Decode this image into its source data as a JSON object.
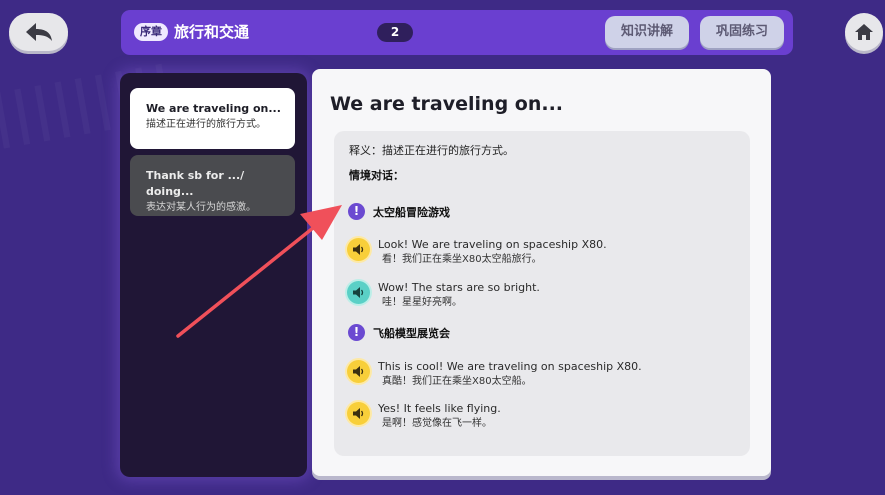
{
  "header": {
    "tag": "序章",
    "title": "旅行和交通",
    "count": "2",
    "tabs": [
      "知识讲解",
      "巩固练习"
    ]
  },
  "sidebar": {
    "items": [
      {
        "title": "We are traveling on...",
        "desc": "描述正在进行的旅行方式。",
        "active": true
      },
      {
        "title": "Thank sb for .../ doing...",
        "desc": "表达对某人行为的感激。",
        "active": false
      }
    ]
  },
  "content": {
    "title": "We are traveling on...",
    "definition": "释义：描述正在进行的旅行方式。",
    "dialog_heading": "情境对话：",
    "scenes": [
      {
        "name": "太空船冒险游戏",
        "lines": [
          {
            "en": "Look! We are traveling on spaceship X80.",
            "zh": "看！我们正在乘坐X80太空船旅行。",
            "speaker_color": "yellow"
          },
          {
            "en": "Wow! The stars are so bright.",
            "zh": "哇！星星好亮啊。",
            "speaker_color": "teal"
          }
        ]
      },
      {
        "name": "飞船模型展览会",
        "lines": [
          {
            "en": "This is cool! We are traveling on spaceship X80.",
            "zh": "真酷！我们正在乘坐X80太空船。",
            "speaker_color": "yellow"
          },
          {
            "en": "Yes! It feels like flying.",
            "zh": "是啊！感觉像在飞一样。",
            "speaker_color": "yellow"
          }
        ]
      }
    ]
  },
  "icons": {
    "back": "back-arrow-icon",
    "home": "home-icon",
    "scene": "exclamation-icon",
    "speaker": "speaker-icon"
  },
  "colors": {
    "background": "#3e2a86",
    "topbar": "#6a3fd0",
    "accent_yellow": "#f8cf3a",
    "accent_teal": "#5ad0c6",
    "scene_icon": "#6b4ad1",
    "annotation_arrow": "#f0505a"
  }
}
